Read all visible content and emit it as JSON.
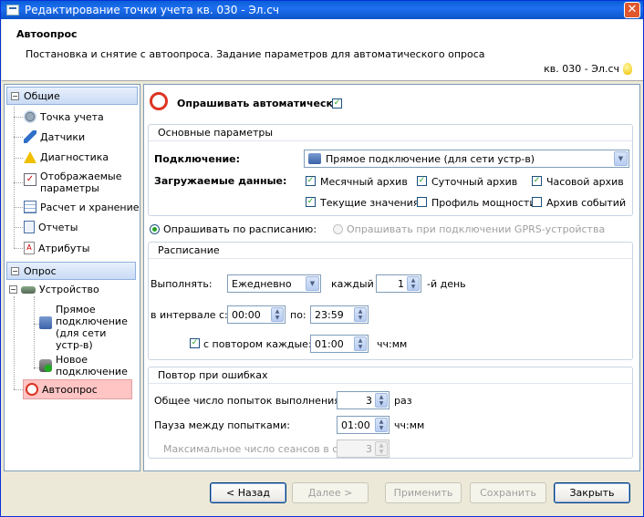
{
  "window": {
    "title": "Редактирование точки учета кв. 030 - Эл.сч",
    "close": "✕"
  },
  "header": {
    "title": "Автоопрос",
    "description": "Постановка и снятие с автоопроса. Задание параметров для автоматического опроса",
    "point": "кв. 030 - Эл.сч"
  },
  "nav": {
    "group1": {
      "label": "Общие",
      "toggle": "−"
    },
    "items1": [
      "Точка учета",
      "Датчики",
      "Диагностика",
      "Отображаемые параметры",
      "Расчет и хранение",
      "Отчеты",
      "Атрибуты"
    ],
    "group2": {
      "label": "Опрос",
      "toggle": "−"
    },
    "device": {
      "label": "Устройство",
      "toggle": "−"
    },
    "device_children": [
      "Прямое подключение (для сети устр-в)",
      "Новое подключение"
    ],
    "autopoll": "Автоопрос"
  },
  "main": {
    "auto_label": "Опрашивать автоматически",
    "auto_checked": true,
    "basic": {
      "title": "Основные параметры",
      "connection_label": "Подключение:",
      "connection_value": "Прямое подключение (для сети устр-в)",
      "loaded_label": "Загружаемые данные:",
      "options": [
        {
          "label": "Месячный архив",
          "checked": true
        },
        {
          "label": "Суточный архив",
          "checked": true
        },
        {
          "label": "Часовой архив",
          "checked": true
        },
        {
          "label": "Текущие значения",
          "checked": true
        },
        {
          "label": "Профиль мощности",
          "checked": false
        },
        {
          "label": "Архив событий",
          "checked": false
        }
      ]
    },
    "mode": {
      "schedule": "Опрашивать по расписанию:",
      "gprs": "Опрашивать при подключении GPRS-устройства"
    },
    "schedule": {
      "title": "Расписание",
      "run_label": "Выполнять:",
      "run_value": "Ежедневно",
      "every_label": "каждый",
      "day_value": "1",
      "day_suffix": "-й день",
      "interval_label": "в интервале с:",
      "from": "00:00",
      "to_label": "по:",
      "to": "23:59",
      "repeat_label": "с повтором каждые:",
      "repeat_checked": true,
      "repeat_value": "01:00",
      "repeat_unit": "чч:мм"
    },
    "retry": {
      "title": "Повтор при ошибках",
      "total_label": "Общее число попыток выполнения:",
      "total_value": "3",
      "total_unit": "раз",
      "pause_label": "Пауза между попытками:",
      "pause_value": "01:00",
      "pause_unit": "чч:мм",
      "max_label": "Максимальное число сеансов в сутки:",
      "max_value": "3"
    }
  },
  "buttons": {
    "back": "< Назад",
    "next": "Далее >",
    "apply": "Применить",
    "save": "Сохранить",
    "close": "Закрыть"
  },
  "colors": {
    "titlebar": "#0a5fd8",
    "selected": "#ffc4c4",
    "check": "#21a121"
  }
}
